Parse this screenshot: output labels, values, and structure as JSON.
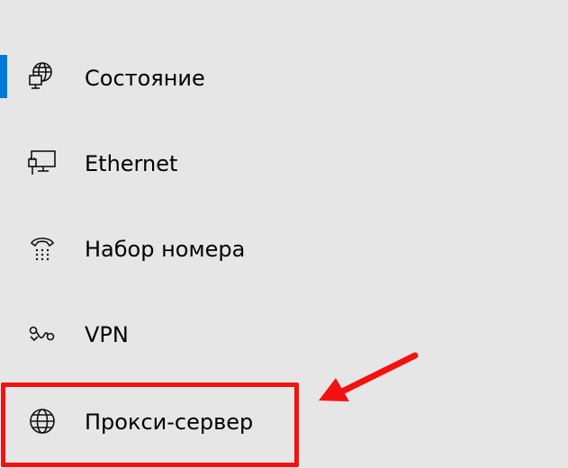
{
  "nav": {
    "accent_color": "#0078d7",
    "highlight_color": "#f41111",
    "items": [
      {
        "label": "Состояние",
        "icon": "globe-monitor-icon",
        "selected": true
      },
      {
        "label": "Ethernet",
        "icon": "ethernet-monitor-icon",
        "selected": false
      },
      {
        "label": "Набор номера",
        "icon": "dialup-phone-icon",
        "selected": false
      },
      {
        "label": "VPN",
        "icon": "vpn-icon",
        "selected": false
      },
      {
        "label": "Прокси-сервер",
        "icon": "globe-icon",
        "selected": false,
        "highlighted": true
      }
    ]
  }
}
